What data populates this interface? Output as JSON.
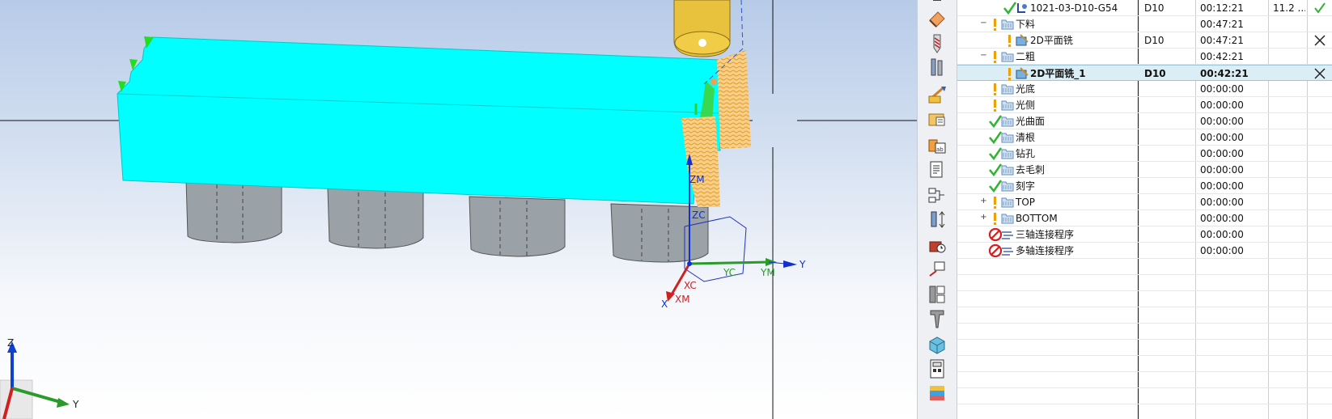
{
  "viewport": {
    "axis_labels": {
      "zm": "ZM",
      "zc": "ZC",
      "yc": "YC",
      "ym": "YM",
      "y": "Y",
      "xc": "XC",
      "xm": "XM",
      "x": "X"
    },
    "triad_labels": {
      "z": "Z",
      "y": "Y"
    }
  },
  "resource_bar": {
    "icons": [
      "operation-icon",
      "eraser-icon",
      "tool-icon",
      "tool-holder-icon",
      "machining-icon",
      "program-group-icon",
      "shop-doc-icon",
      "report-icon",
      "process-icon",
      "tool-axis-icon",
      "machine-icon",
      "view-icon",
      "tool-list-icon",
      "drill-tool-icon",
      "stock-icon",
      "calculator-icon",
      "color-palette-icon"
    ]
  },
  "navigator": {
    "rows": [
      {
        "name": "1021-03-D10-G54",
        "tool": "D10",
        "time": "00:12:21",
        "extra": "11.2 ...",
        "status": "check",
        "type": "tool-path",
        "level": 3,
        "expander": "",
        "end": "check"
      },
      {
        "name": "下料",
        "tool": "",
        "time": "00:47:21",
        "extra": "",
        "status": "warn",
        "type": "folder",
        "level": 1,
        "expander": "−",
        "end": ""
      },
      {
        "name": "2D平面铣",
        "tool": "D10",
        "time": "00:47:21",
        "extra": "",
        "status": "warn",
        "type": "operation",
        "level": 2,
        "expander": "",
        "end": "cross"
      },
      {
        "name": "二粗",
        "tool": "",
        "time": "00:42:21",
        "extra": "",
        "status": "warn",
        "type": "folder",
        "level": 1,
        "expander": "−",
        "end": ""
      },
      {
        "name": "2D平面铣_1",
        "tool": "D10",
        "time": "00:42:21",
        "extra": "",
        "status": "warn",
        "type": "operation",
        "level": 2,
        "expander": "",
        "end": "cross",
        "selected": true
      },
      {
        "name": "光底",
        "tool": "",
        "time": "00:00:00",
        "extra": "",
        "status": "warn",
        "type": "folder",
        "level": 1,
        "expander": "",
        "end": ""
      },
      {
        "name": "光侧",
        "tool": "",
        "time": "00:00:00",
        "extra": "",
        "status": "warn",
        "type": "folder",
        "level": 1,
        "expander": "",
        "end": ""
      },
      {
        "name": "光曲面",
        "tool": "",
        "time": "00:00:00",
        "extra": "",
        "status": "check",
        "type": "folder",
        "level": 1,
        "expander": "",
        "end": ""
      },
      {
        "name": "清根",
        "tool": "",
        "time": "00:00:00",
        "extra": "",
        "status": "check",
        "type": "folder",
        "level": 1,
        "expander": "",
        "end": ""
      },
      {
        "name": "钻孔",
        "tool": "",
        "time": "00:00:00",
        "extra": "",
        "status": "check",
        "type": "folder",
        "level": 1,
        "expander": "",
        "end": ""
      },
      {
        "name": "去毛刺",
        "tool": "",
        "time": "00:00:00",
        "extra": "",
        "status": "check",
        "type": "folder",
        "level": 1,
        "expander": "",
        "end": ""
      },
      {
        "name": "刻字",
        "tool": "",
        "time": "00:00:00",
        "extra": "",
        "status": "check",
        "type": "folder",
        "level": 1,
        "expander": "",
        "end": ""
      },
      {
        "name": "TOP",
        "tool": "",
        "time": "00:00:00",
        "extra": "",
        "status": "warn",
        "type": "folder",
        "level": 1,
        "expander": "+",
        "end": ""
      },
      {
        "name": "BOTTOM",
        "tool": "",
        "time": "00:00:00",
        "extra": "",
        "status": "warn",
        "type": "folder",
        "level": 1,
        "expander": "+",
        "end": ""
      },
      {
        "name": "三轴连接程序",
        "tool": "",
        "time": "00:00:00",
        "extra": "",
        "status": "prohibited",
        "type": "link",
        "level": 1,
        "expander": "",
        "end": ""
      },
      {
        "name": "多轴连接程序",
        "tool": "",
        "time": "00:00:00",
        "extra": "",
        "status": "prohibited",
        "type": "link",
        "level": 1,
        "expander": "",
        "end": ""
      }
    ]
  },
  "colors": {
    "part_cyan": "#00ffff",
    "selected_row": "#dbeef5",
    "check_green": "#2fb52f",
    "warn_orange": "#f0a000",
    "prohibited_red": "#d42020",
    "folder_blue": "#5e8fc1"
  }
}
